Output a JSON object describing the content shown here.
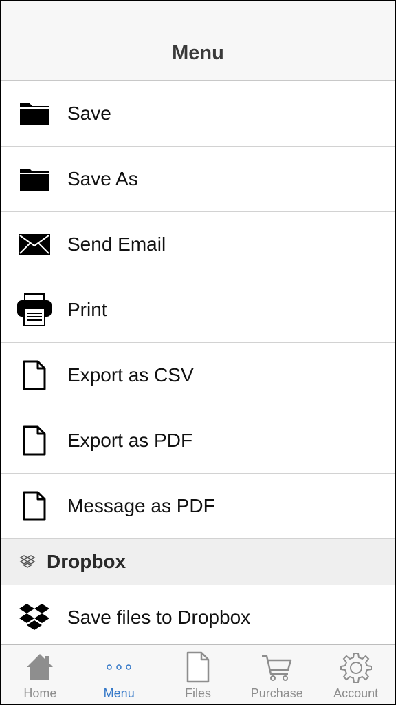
{
  "navbar": {
    "title": "Menu"
  },
  "menu": {
    "items": [
      {
        "label": "Save",
        "icon": "folder-icon"
      },
      {
        "label": "Save As",
        "icon": "folder-icon"
      },
      {
        "label": "Send Email",
        "icon": "envelope-icon"
      },
      {
        "label": "Print",
        "icon": "printer-icon"
      },
      {
        "label": "Export as CSV",
        "icon": "document-icon"
      },
      {
        "label": "Export as PDF",
        "icon": "document-icon"
      },
      {
        "label": "Message as PDF",
        "icon": "document-icon"
      }
    ],
    "dropbox_section": {
      "header": "Dropbox",
      "icon": "dropbox-icon",
      "items": [
        {
          "label": "Save files to Dropbox",
          "icon": "dropbox-icon"
        }
      ]
    }
  },
  "tabbar": {
    "tabs": [
      {
        "label": "Home",
        "icon": "home-icon",
        "active": false
      },
      {
        "label": "Menu",
        "icon": "more-dots-icon",
        "active": true
      },
      {
        "label": "Files",
        "icon": "file-icon",
        "active": false
      },
      {
        "label": "Purchase",
        "icon": "cart-icon",
        "active": false
      },
      {
        "label": "Account",
        "icon": "gear-icon",
        "active": false
      }
    ]
  },
  "colors": {
    "accent": "#3478c8",
    "inactive_tab": "#8e8e8e",
    "section_bg": "#efefef",
    "bar_bg": "#f7f7f7"
  }
}
